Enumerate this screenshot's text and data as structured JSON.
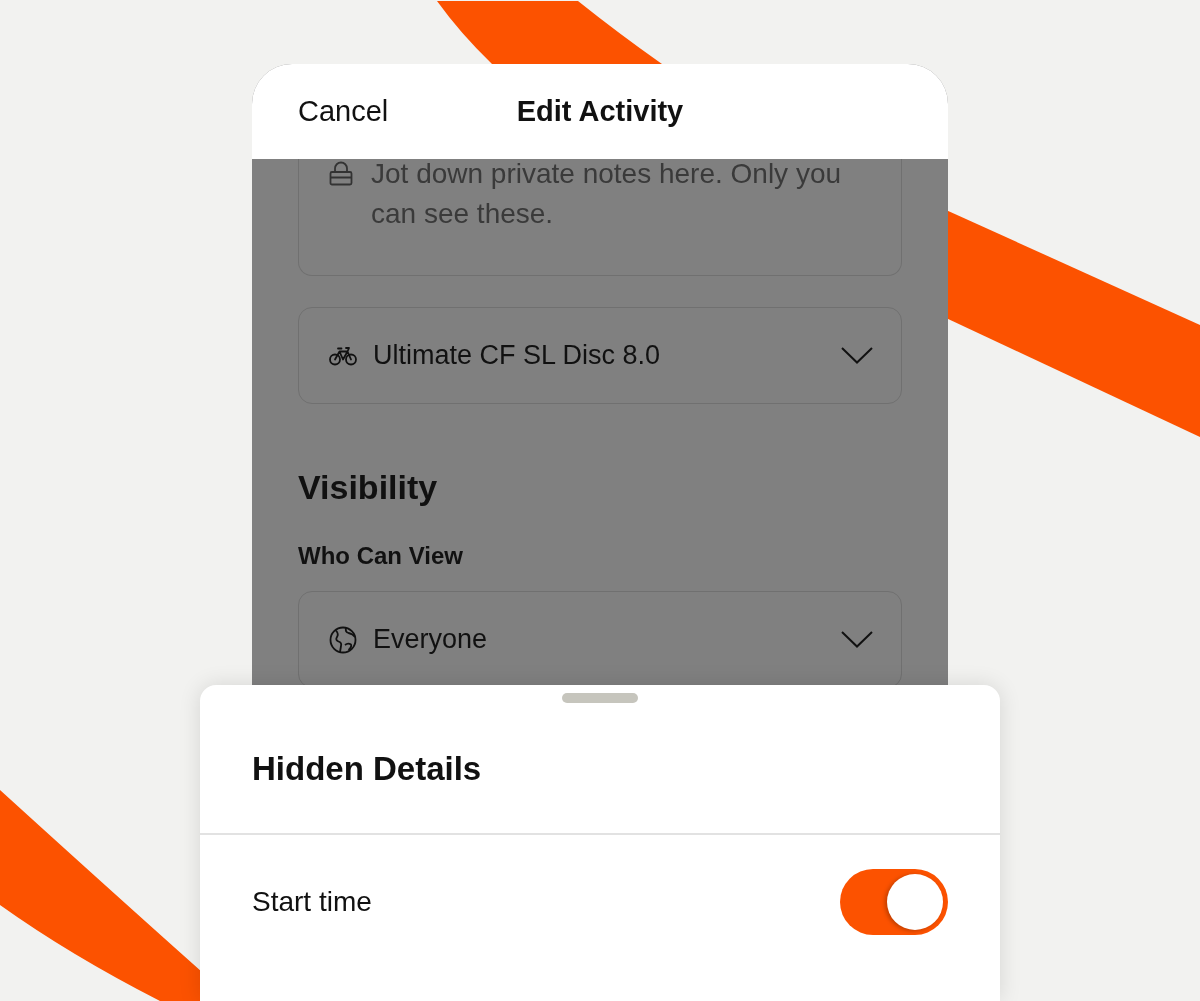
{
  "header": {
    "cancel": "Cancel",
    "title": "Edit Activity"
  },
  "notes": {
    "placeholder": "Jot down private notes here. Only you can see these."
  },
  "gear": {
    "value": "Ultimate CF SL Disc 8.0"
  },
  "visibility": {
    "heading": "Visibility",
    "label": "Who Can View",
    "value": "Everyone"
  },
  "sheet": {
    "title": "Hidden Details",
    "rows": [
      {
        "label": "Start time",
        "on": true
      }
    ]
  }
}
